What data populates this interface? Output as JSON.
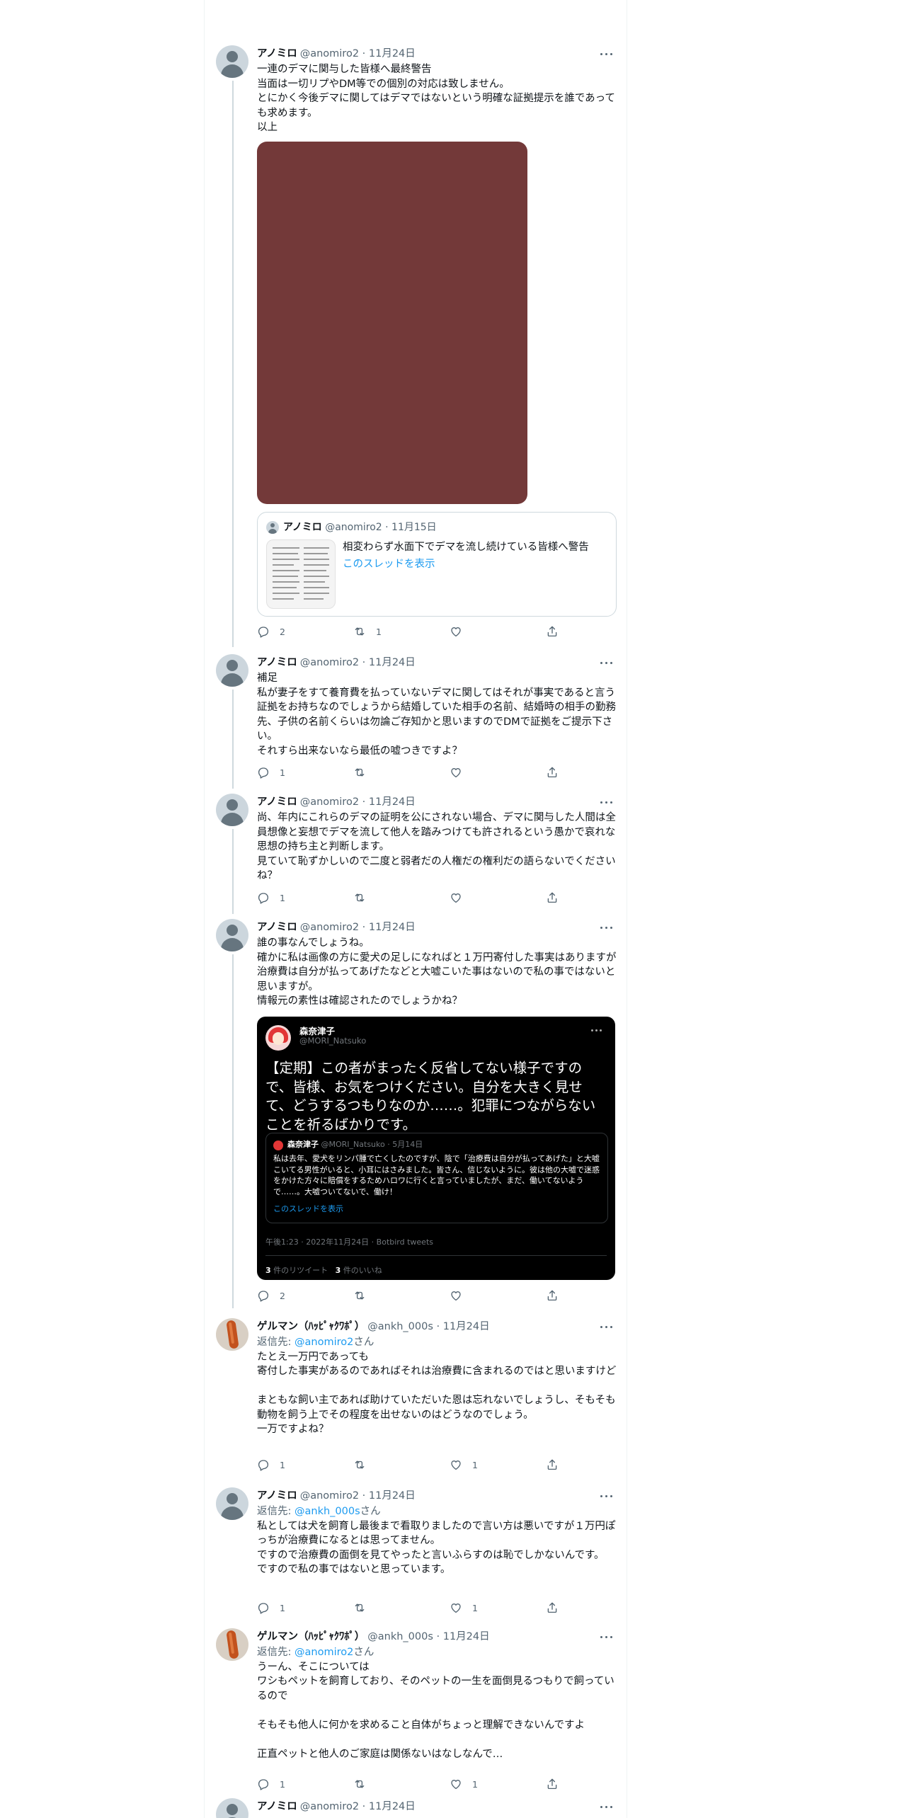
{
  "tweets": [
    {
      "name": "アノミロ",
      "handle": "@anomiro2",
      "date": "11月24日",
      "text": "一連のデマに関与した皆様へ最終警告\n当面は一切リプやDM等での個別の対応は致しません。\nとにかく今後デマに関してはデマではないという明確な証拠提示を誰であっても求めます。\n以上",
      "quote": {
        "name": "アノミロ",
        "handle": "@anomiro2",
        "date": "11月15日",
        "text": "相変わらず水面下でデマを流し続けている皆様へ警告",
        "link": "このスレッドを表示"
      },
      "counts": {
        "reply": "2",
        "retweet": "1",
        "like": ""
      }
    },
    {
      "name": "アノミロ",
      "handle": "@anomiro2",
      "date": "11月24日",
      "text": "補足\n私が妻子をすて養育費を払っていないデマに関してはそれが事実であると言う証拠をお持ちなのでしょうから結婚していた相手の名前、結婚時の相手の勤務先、子供の名前くらいは勿論ご存知かと思いますのでDMで証拠をご提示下さい。\nそれすら出来ないなら最低の嘘つきですよ？",
      "counts": {
        "reply": "1",
        "retweet": "",
        "like": ""
      }
    },
    {
      "name": "アノミロ",
      "handle": "@anomiro2",
      "date": "11月24日",
      "text": "尚、年内にこれらのデマの証明を公にされない場合、デマに関与した人間は全員想像と妄想でデマを流して他人を踏みつけても許されるという愚かで哀れな思想の持ち主と判断します。\n見ていて恥ずかしいので二度と弱者だの人権だの権利だの語らないでくださいね？",
      "counts": {
        "reply": "1",
        "retweet": "",
        "like": ""
      }
    },
    {
      "name": "アノミロ",
      "handle": "@anomiro2",
      "date": "11月24日",
      "text": "誰の事なんでしょうね。\n確かに私は画像の方に愛犬の足しになればと１万円寄付した事実はありますが治療費は自分が払ってあげたなどと大嘘こいた事はないので私の事ではないと思いますが。\n情報元の素性は確認されたのでしょうかね？",
      "embed": {
        "name": "森奈津子",
        "handle": "@MORI_Natsuko",
        "text": "【定期】この者がまったく反省してない様子ですので、皆様、お気をつけください。自分を大きく見せて、どうするつもりなのか……。犯罪につながらないことを祈るばかりです。",
        "inner_name": "森奈津子",
        "inner_meta": "@MORI_Natsuko · 5月14日",
        "inner_text": "私は去年、愛犬をリンパ腫で亡くしたのですが、陰で「治療費は自分が払ってあげた」と大嘘こいてる男性がいると、小耳にはさみました。皆さん、信じないように。彼は他の大嘘で迷惑をかけた方々に賠償をするためハロワに行くと言っていましたが、まだ、働いてないようで……。大嘘ついてないで、働け！",
        "inner_link": "このスレッドを表示",
        "footer": "午後1:23 · 2022年11月24日 · Botbird tweets",
        "retweets_num": "3",
        "retweets_label": "件のリツイート",
        "likes_num": "3",
        "likes_label": "件のいいね"
      },
      "counts": {
        "reply": "2",
        "retweet": "",
        "like": ""
      }
    },
    {
      "name": "ゲルマン（ﾊｯﾋﾟｬｸﾜﾎﾟ）",
      "handle": "@ankh_000s",
      "date": "11月24日",
      "reply_prefix": "返信先: ",
      "reply_handle": "@anomiro2",
      "reply_suffix": "さん",
      "text": "たとえ一万円であっても\n寄付した事実があるのであればそれは治療費に含まれるのではと思いますけど\n\nまともな飼い主であれば助けていただいた恩は忘れないでしょうし、そもそも動物を飼う上でその程度を出せないのはどうなのでしょう。\n一万ですよね？",
      "counts": {
        "reply": "1",
        "retweet": "",
        "like": "1"
      }
    },
    {
      "name": "アノミロ",
      "handle": "@anomiro2",
      "date": "11月24日",
      "reply_prefix": "返信先: ",
      "reply_handle": "@ankh_000s",
      "reply_suffix": "さん",
      "text": "私としては犬を飼育し最後まで看取りましたので言い方は悪いですが１万円ぽっちが治療費になるとは思ってません。\nですので治療費の面倒を見てやったと言いふらすのは恥でしかないんです。\nですので私の事ではないと思っています。",
      "counts": {
        "reply": "1",
        "retweet": "",
        "like": "1"
      }
    },
    {
      "name": "ゲルマン（ﾊｯﾋﾟｬｸﾜﾎﾟ）",
      "handle": "@ankh_000s",
      "date": "11月24日",
      "reply_prefix": "返信先: ",
      "reply_handle": "@anomiro2",
      "reply_suffix": "さん",
      "text": "うーん、そこについては\nワシもペットを飼育しており、そのペットの一生を面倒見るつもりで飼っているので\n\nそもそも他人に何かを求めること自体がちょっと理解できないんですよ\n\n正直ペットと他人のご家庭は関係ないはなしなんで…",
      "counts": {
        "reply": "1",
        "retweet": "",
        "like": "1"
      }
    },
    {
      "name": "アノミロ",
      "handle": "@anomiro2",
      "date": "11月24日"
    }
  ],
  "icons": [
    "more-icon",
    "reply-icon",
    "retweet-icon",
    "like-icon",
    "share-icon"
  ],
  "colors": {
    "link": "#1d9bf0",
    "secondary": "#536471",
    "media": "#733939"
  }
}
